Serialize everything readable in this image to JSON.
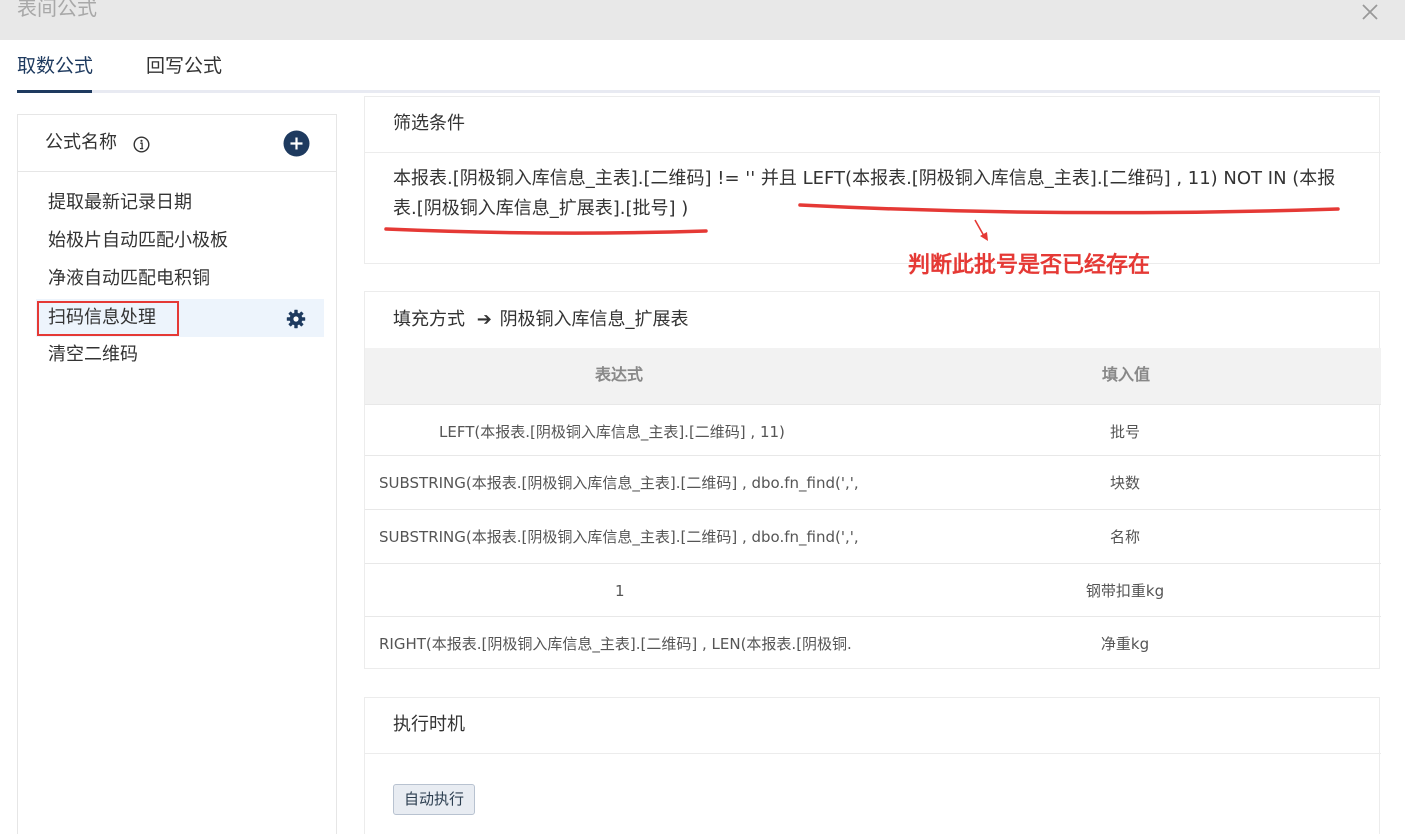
{
  "dialog": {
    "title": "表间公式"
  },
  "tabs": [
    {
      "label": "取数公式",
      "active": true
    },
    {
      "label": "回写公式",
      "active": false
    }
  ],
  "formula_list": {
    "header": "公式名称",
    "items": [
      "提取最新记录日期",
      "始极片自动匹配小极板",
      "净液自动匹配电积铜",
      "扫码信息处理",
      "清空二维码"
    ],
    "selected_index": 3
  },
  "filter": {
    "header": "筛选条件",
    "text": "本报表.[阴极铜入库信息_主表].[二维码] != '' 并且 LEFT(本报表.[阴极铜入库信息_主表].[二维码] , 11) NOT IN (本报表.[阴极铜入库信息_扩展表].[批号] )",
    "annotation": "判断此批号是否已经存在"
  },
  "fill": {
    "header_prefix": "填充方式",
    "arrow": "➔",
    "target_table": "阴极铜入库信息_扩展表",
    "columns": {
      "expression": "表达式",
      "value": "填入值"
    },
    "rows": [
      {
        "expression": "LEFT(本报表.[阴极铜入库信息_主表].[二维码] , 11)",
        "value": "批号"
      },
      {
        "expression": "SUBSTRING(本报表.[阴极铜入库信息_主表].[二维码] , dbo.fn_find(',',",
        "value": "块数"
      },
      {
        "expression": "SUBSTRING(本报表.[阴极铜入库信息_主表].[二维码] , dbo.fn_find(',',",
        "value": "名称"
      },
      {
        "expression": "1",
        "value": "钢带扣重kg"
      },
      {
        "expression": "RIGHT(本报表.[阴极铜入库信息_主表].[二维码] , LEN(本报表.[阴极铜.",
        "value": "净重kg"
      }
    ]
  },
  "execution": {
    "header": "执行时机",
    "button_label": "自动执行"
  },
  "colors": {
    "accent": "#1e3a5f",
    "annotation": "#e53935",
    "selected_bg": "#edf4fc"
  }
}
